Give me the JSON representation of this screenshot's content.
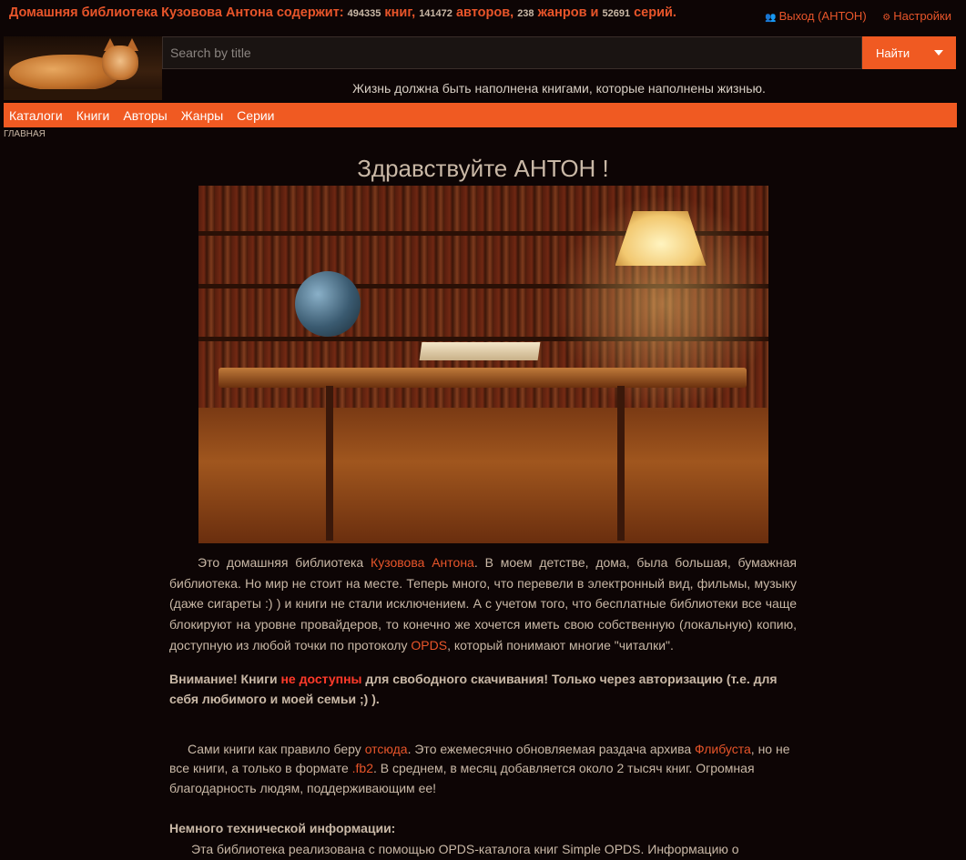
{
  "topbar": {
    "title_prefix": "Домашняя библиотека Кузовова Антона содержит:",
    "books_count": "494335",
    "books_label": "книг,",
    "authors_count": "141472",
    "authors_label": "авторов,",
    "genres_count": "238",
    "genres_label": "жанров и",
    "series_count": "52691",
    "series_label": "серий.",
    "logout_label": "Выход (АНТОН)",
    "settings_label": "Настройки"
  },
  "search": {
    "placeholder": "Search by title",
    "button_label": "Найти"
  },
  "tagline": "Жизнь должна быть наполнена книгами, которые наполнены жизнью.",
  "nav": {
    "items": [
      "Каталоги",
      "Книги",
      "Авторы",
      "Жанры",
      "Серии"
    ]
  },
  "breadcrumb": "ГЛАВНАЯ",
  "greeting": "Здравствуйте АНТОН !",
  "intro": {
    "t1": "Это домашняя библиотека ",
    "link_owner": "Кузовова Антона",
    "t2": ". В моем детстве, дома, была большая, бумажная библиотека. Но мир не стоит на месте. Теперь много, что перевели в электронный вид, фильмы, музыку (даже сигареты :) ) и книги не стали исключением. А с учетом того, что бесплатные библиотеки все чаще блокируют на уровне провайдеров, то конечно же хочется иметь свою собственную (локальную) копию, доступную из любой точки по протоколу ",
    "link_opds": "OPDS",
    "t3": ", который понимают многие \"читалки\"."
  },
  "warning": {
    "t1": "Внимание! Книги ",
    "red": "не доступны",
    "t2": " для свободного скачивания! Только через авторизацию (т.е. для себя любимого и моей семьи ;) )."
  },
  "source": {
    "t1": "Сами книги как правило беру ",
    "link_here": "отсюда",
    "t2": ". Это ежемесячно обновляемая раздача архива ",
    "link_flibusta": "Флибуста",
    "t3": ", но не все книги, а только в формате ",
    "link_fb2": ".fb2",
    "t4": ". В среднем, в месяц добавляется около 2 тысяч книг. Огромная благодарность людям, поддерживающим ее!"
  },
  "tech": {
    "heading": "Немного технической информации:",
    "text": "Эта библиотека реализована с помощью OPDS-каталога книг Simple OPDS. Информацию о"
  },
  "colors": {
    "accent": "#f05a22",
    "background": "#0d0505",
    "text": "#c9b8a6",
    "link": "#e8552a",
    "warning": "#ff3a2a"
  },
  "icons": {
    "logout": "users-icon",
    "settings": "gear-icon"
  }
}
